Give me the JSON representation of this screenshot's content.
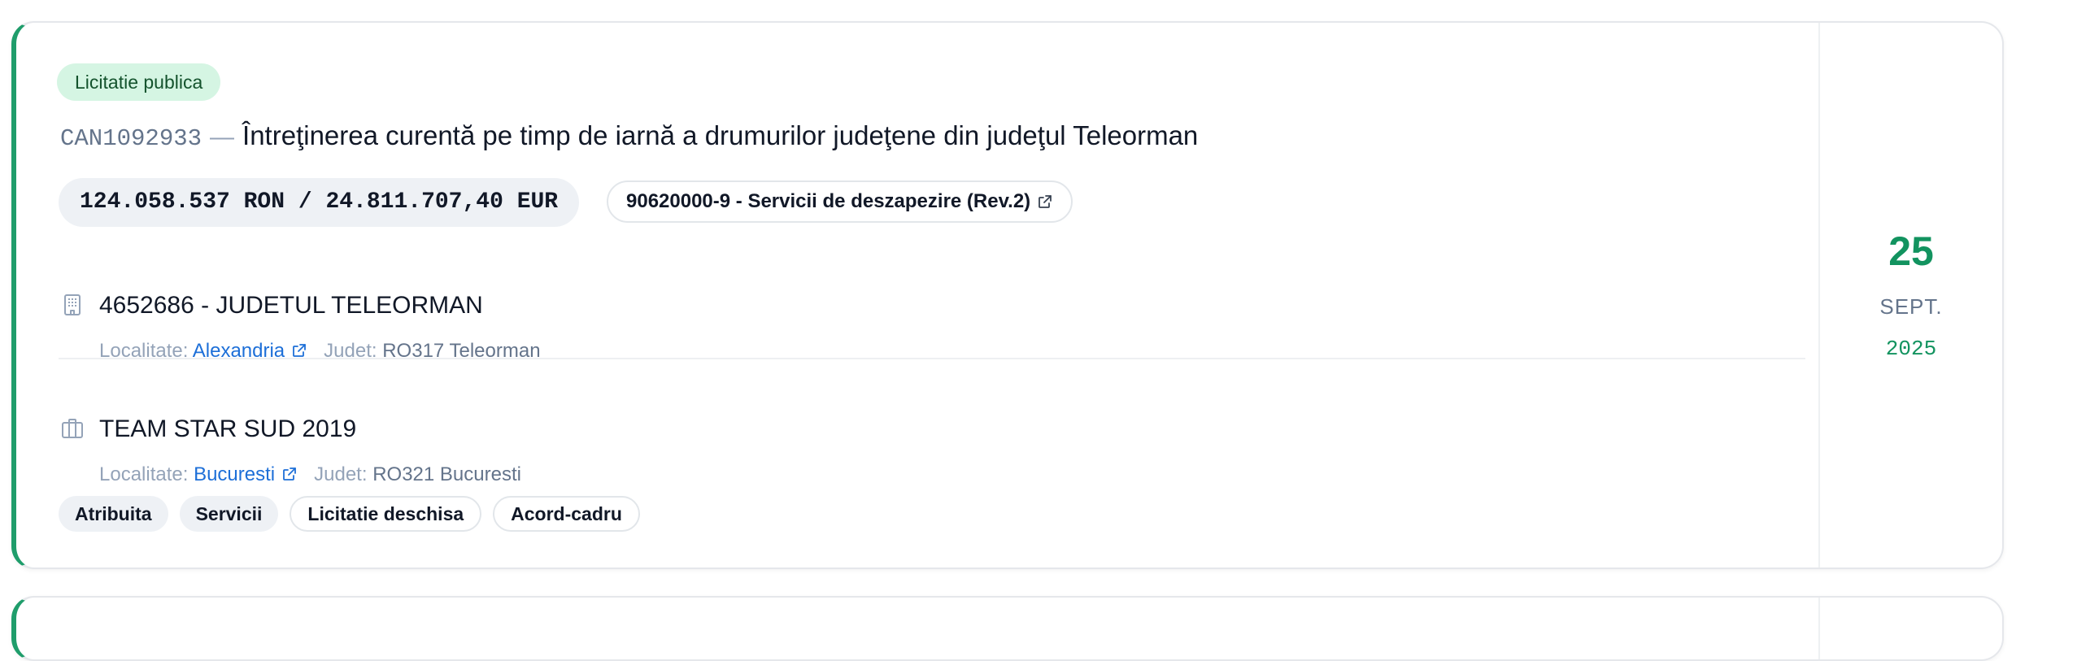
{
  "card": {
    "procedure_type": "Licitatie publica",
    "code": "CAN1092933",
    "separator": "—",
    "title": "Întreţinerea curentă pe timp de iarnă a drumurilor judeţene din judeţul Teleorman",
    "value": "124.058.537 RON / 24.811.707,40 EUR",
    "cpv": "90620000-9 - Servicii de deszapezire (Rev.2)",
    "authority": {
      "name": "4652686 - JUDETUL TELEORMAN",
      "locality_label": "Localitate:",
      "locality": "Alexandria",
      "county_label": "Judet:",
      "county": "RO317 Teleorman",
      "icon": "building-icon"
    },
    "supplier": {
      "name": "TEAM STAR SUD 2019",
      "locality_label": "Localitate:",
      "locality": "Bucuresti",
      "county_label": "Judet:",
      "county": "RO321 Bucuresti",
      "icon": "briefcase-icon"
    },
    "tags": [
      "Atribuita",
      "Servicii",
      "Licitatie deschisa",
      "Acord-cadru"
    ],
    "date": {
      "day": "25",
      "month": "SEPT.",
      "year": "2025"
    }
  },
  "colors": {
    "accent": "#1f9d6b",
    "date_green": "#12935f",
    "link": "#1d6fd8",
    "badge_bg": "#d5f5e3"
  }
}
